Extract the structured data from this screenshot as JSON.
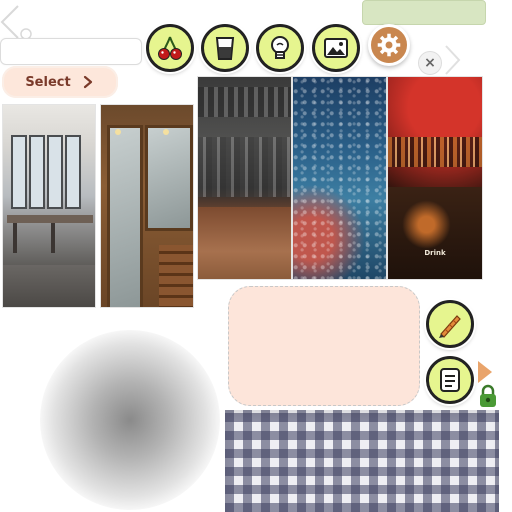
{
  "select_button": {
    "label": "Select"
  },
  "close_button": {
    "label": "×"
  },
  "photos": [
    {
      "name": "restaurant-interior"
    },
    {
      "name": "wooden-doors"
    },
    {
      "name": "bar-counter"
    },
    {
      "name": "rainy-window"
    },
    {
      "name": "pub-interior",
      "label": "Drink"
    }
  ],
  "icons": {
    "cherries": "cherries-icon",
    "drink": "glass-icon",
    "lightbulb": "lightbulb-icon",
    "image": "image-icon",
    "settings": "gear-icon",
    "pencil": "pencil-icon",
    "document": "document-icon",
    "lock": "lock-icon"
  },
  "colors": {
    "button_fill": "#e6f58f",
    "button_border": "#222222",
    "gear_fill": "#c9874f",
    "select_fill": "#fde7db",
    "note_fill": "#fde5da",
    "tablecloth_check": "#3c3e5f",
    "top_pill": "#d8e6c2"
  }
}
